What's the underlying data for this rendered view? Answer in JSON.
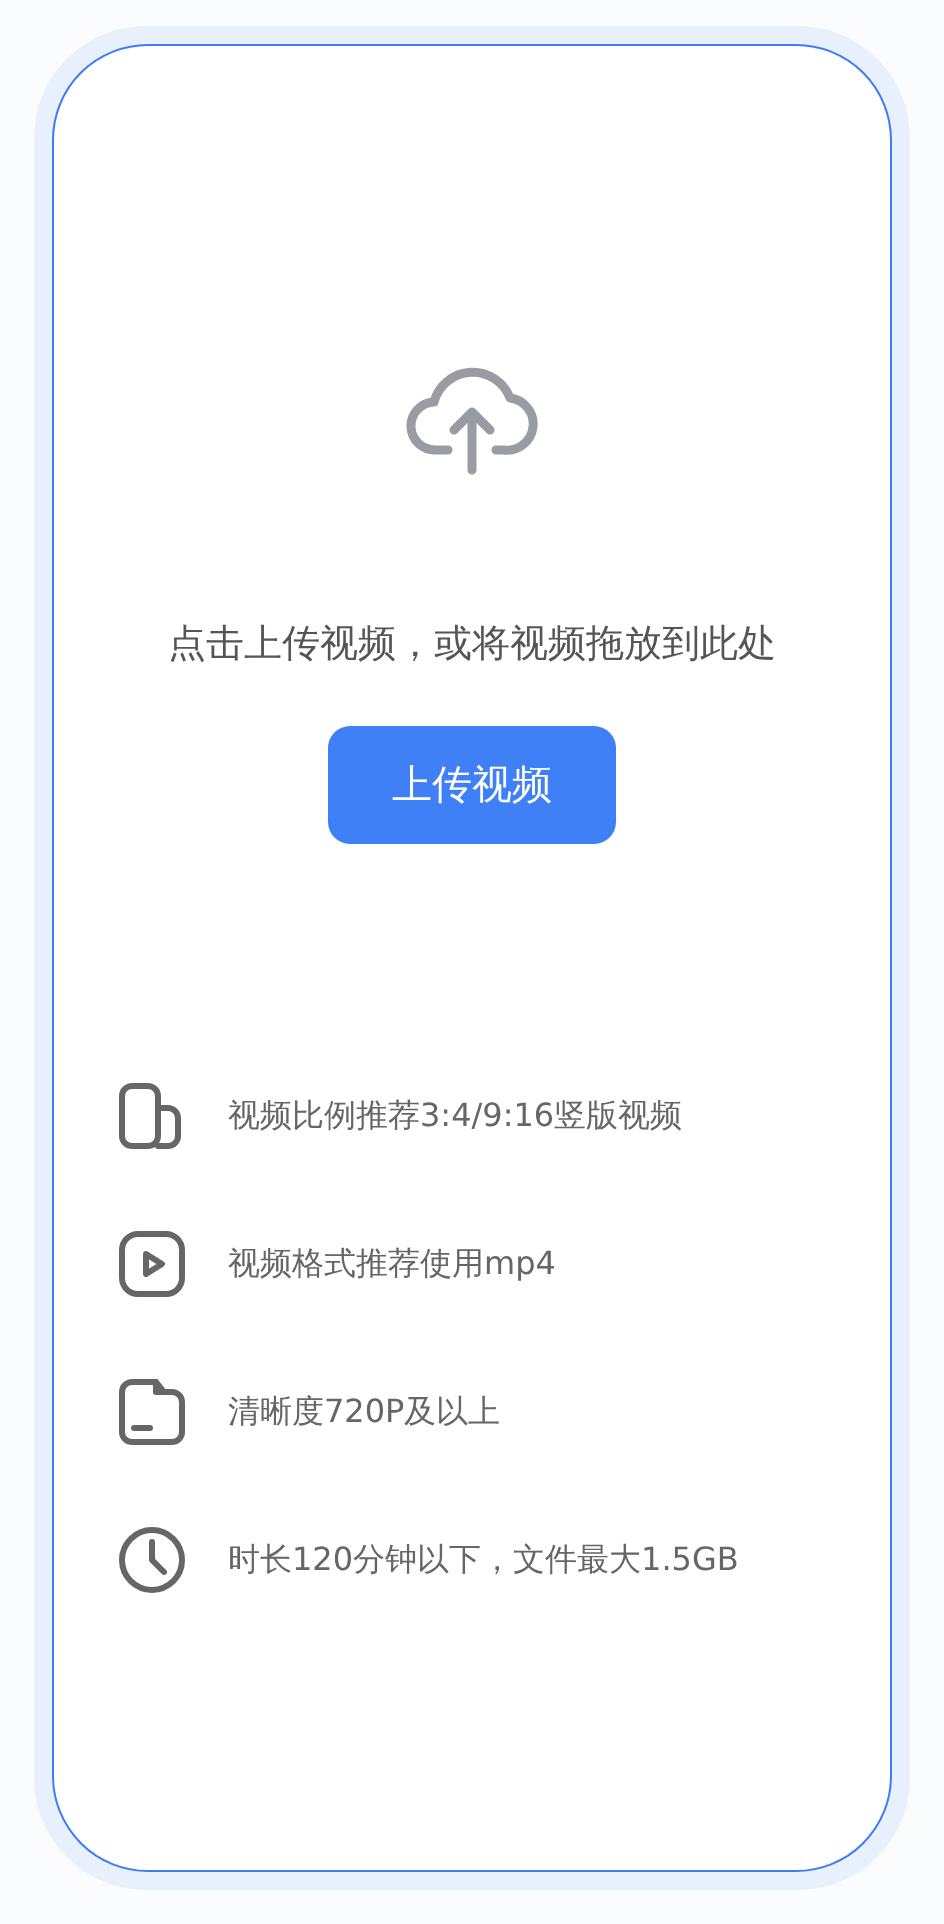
{
  "upload": {
    "prompt": "点击上传视频，或将视频拖放到此处",
    "button": "上传视频"
  },
  "tips": [
    {
      "kind": "ratio",
      "text": "视频比例推荐3:4/9:16竖版视频"
    },
    {
      "kind": "format",
      "text": "视频格式推荐使用mp4"
    },
    {
      "kind": "resolution",
      "text": "清晰度720P及以上"
    },
    {
      "kind": "duration",
      "text": "时长120分钟以下，文件最大1.5GB"
    }
  ]
}
